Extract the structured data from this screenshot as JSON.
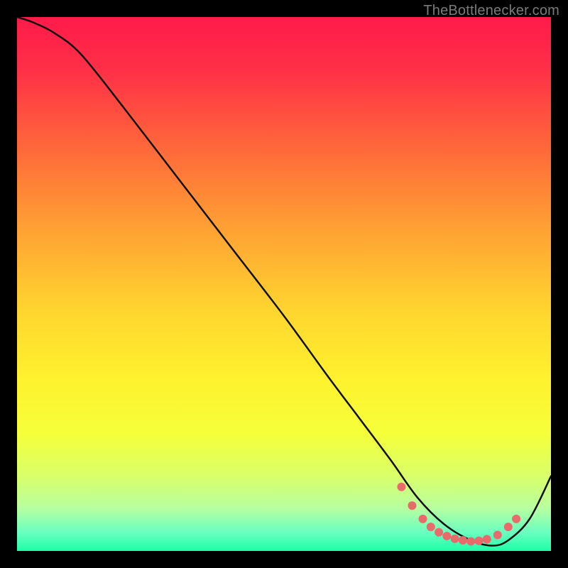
{
  "watermark": "TheBottlenecker.com",
  "chart_data": {
    "type": "line",
    "title": "",
    "xlabel": "",
    "ylabel": "",
    "xlim": [
      0,
      100
    ],
    "ylim": [
      0,
      100
    ],
    "series": [
      {
        "name": "curve",
        "x": [
          0,
          3,
          7,
          12,
          20,
          30,
          40,
          50,
          58,
          64,
          70,
          75,
          80,
          85,
          89,
          92,
          96,
          100
        ],
        "y": [
          100,
          99,
          97,
          93,
          83,
          70,
          57,
          44,
          33,
          25,
          17,
          10,
          5,
          2,
          1,
          2,
          6,
          14
        ]
      }
    ],
    "markers": {
      "name": "dots",
      "x": [
        72,
        74,
        76,
        77.5,
        79,
        80.5,
        82,
        83.5,
        85,
        86.5,
        88,
        90,
        92,
        93.5
      ],
      "y": [
        12,
        8.5,
        6,
        4.5,
        3.5,
        2.8,
        2.3,
        2,
        1.8,
        1.9,
        2.2,
        3,
        4.5,
        6
      ]
    },
    "gradient_stops": [
      {
        "offset": 0.0,
        "color": "#ff1a4a"
      },
      {
        "offset": 0.1,
        "color": "#ff3047"
      },
      {
        "offset": 0.25,
        "color": "#ff6a3a"
      },
      {
        "offset": 0.4,
        "color": "#ffa233"
      },
      {
        "offset": 0.55,
        "color": "#ffd52f"
      },
      {
        "offset": 0.68,
        "color": "#fff22e"
      },
      {
        "offset": 0.78,
        "color": "#f5ff3a"
      },
      {
        "offset": 0.86,
        "color": "#d9ff6a"
      },
      {
        "offset": 0.92,
        "color": "#b7ffa0"
      },
      {
        "offset": 0.965,
        "color": "#6affc0"
      },
      {
        "offset": 1.0,
        "color": "#1effa8"
      }
    ],
    "marker_color": "#e96a6a",
    "line_color": "#111111"
  }
}
